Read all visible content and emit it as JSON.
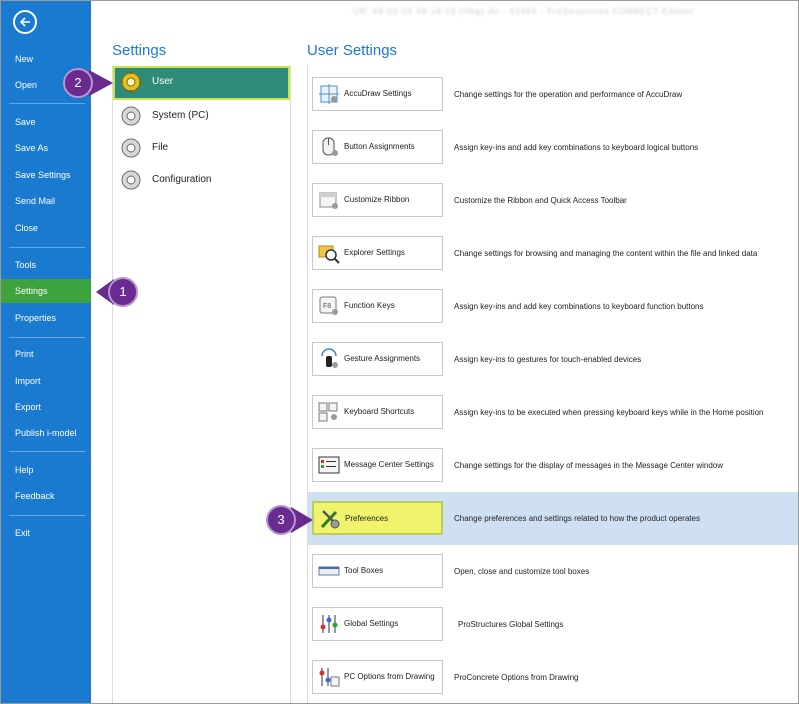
{
  "title_blur": "UR: 08-01-05 08-18-19 (Hbg) 3U - 01456 - ProStructures CONNECT Edition",
  "nav": {
    "back": "Back",
    "items": [
      {
        "label": "New"
      },
      {
        "label": "Open"
      },
      {
        "label": "Save"
      },
      {
        "label": "Save As"
      },
      {
        "label": "Save Settings"
      },
      {
        "label": "Send Mail"
      },
      {
        "label": "Close"
      },
      {
        "label": "Tools"
      },
      {
        "label": "Settings",
        "active": true
      },
      {
        "label": "Properties"
      },
      {
        "label": "Print"
      },
      {
        "label": "Import"
      },
      {
        "label": "Export"
      },
      {
        "label": "Publish i-model"
      },
      {
        "label": "Help"
      },
      {
        "label": "Feedback"
      },
      {
        "label": "Exit"
      }
    ]
  },
  "settings": {
    "title": "Settings",
    "items": [
      {
        "label": "User",
        "active": true
      },
      {
        "label": "System (PC)"
      },
      {
        "label": "File"
      },
      {
        "label": "Configuration"
      }
    ]
  },
  "user_settings": {
    "title": "User Settings",
    "items": [
      {
        "label": "AccuDraw Settings",
        "desc": "Change settings for the operation and performance of AccuDraw",
        "icon": "accudraw-icon"
      },
      {
        "label": "Button Assignments",
        "desc": "Assign key-ins and add key combinations to keyboard logical buttons",
        "icon": "mouse-icon"
      },
      {
        "label": "Customize Ribbon",
        "desc": "Customize the Ribbon and Quick Access Toolbar",
        "icon": "ribbon-icon"
      },
      {
        "label": "Explorer Settings",
        "desc": "Change settings for browsing and managing the content within the file and linked data",
        "icon": "explorer-icon"
      },
      {
        "label": "Function Keys",
        "desc": "Assign key-ins and add key combinations to keyboard function buttons",
        "icon": "function-key-icon"
      },
      {
        "label": "Gesture Assignments",
        "desc": "Assign key-ins to gestures for touch-enabled devices",
        "icon": "gesture-icon"
      },
      {
        "label": "Keyboard Shortcuts",
        "desc": "Assign key-ins to be executed when pressing keyboard keys while in the Home position",
        "icon": "keyboard-icon"
      },
      {
        "label": "Message Center Settings",
        "desc": "Change settings for the display of messages in the Message Center window",
        "icon": "message-center-icon"
      },
      {
        "label": "Preferences",
        "desc": "Change preferences and settings related to how the product operates",
        "icon": "preferences-icon",
        "active": true
      },
      {
        "label": "Tool Boxes",
        "desc": "Open, close and customize tool boxes",
        "icon": "toolbox-icon"
      },
      {
        "label": "Global Settings",
        "desc": "ProStructures Global Settings",
        "icon": "global-settings-icon"
      },
      {
        "label": "PC Options from Drawing",
        "desc": "ProConcrete Options from Drawing",
        "icon": "pc-options-icon"
      }
    ]
  },
  "callouts": {
    "one": "1",
    "two": "2",
    "three": "3"
  },
  "colors": {
    "nav_bg": "#1a7ad0",
    "nav_active": "#3ea33e",
    "user_active": "#2e8b77",
    "highlight_yellow": "#f0f46c",
    "row_active": "#cfe0f3",
    "callout": "#6a2a8f"
  }
}
